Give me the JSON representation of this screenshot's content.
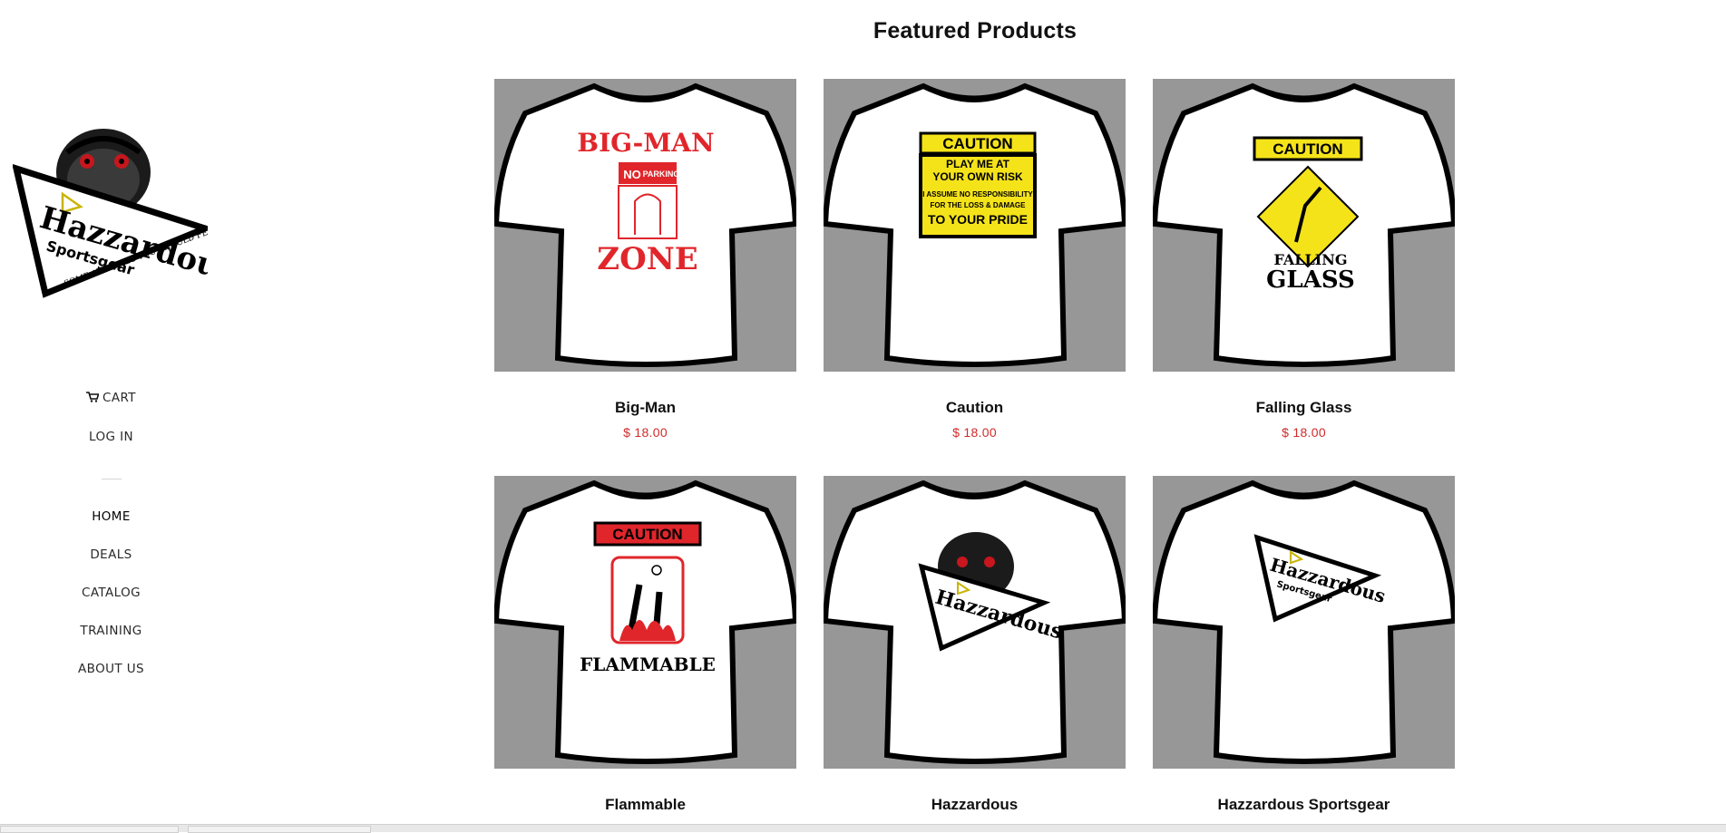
{
  "brand": {
    "logo_text": "Hazzardous",
    "logo_subtext": "Sportsgear",
    "logo_tagline": "SOME ATHLETES YOU SHOULD FEAR..."
  },
  "account_nav": {
    "cart_label": "CART",
    "login_label": "LOG IN"
  },
  "main_nav": [
    {
      "label": "HOME"
    },
    {
      "label": "DEALS"
    },
    {
      "label": "CATALOG"
    },
    {
      "label": "TRAINING"
    },
    {
      "label": "ABOUT US"
    }
  ],
  "featured": {
    "title": "Featured Products",
    "products": [
      {
        "name": "Big-Man",
        "price": "$ 18.00",
        "design": "big-man",
        "art": [
          "BIG-MAN",
          "NO",
          "PARKING",
          "ZONE"
        ]
      },
      {
        "name": "Caution",
        "price": "$ 18.00",
        "design": "caution",
        "art": [
          "CAUTION",
          "PLAY ME AT",
          "YOUR OWN RISK",
          "I ASSUME NO RESPONSIBILITY",
          "FOR THE LOSS & DAMAGE",
          "TO YOUR PRIDE"
        ]
      },
      {
        "name": "Falling Glass",
        "price": "$ 18.00",
        "design": "falling-glass",
        "art": [
          "CAUTION",
          "FALLING",
          "GLASS"
        ]
      },
      {
        "name": "Flammable",
        "design": "flammable",
        "art": [
          "CAUTION",
          "FLAMMABLE"
        ]
      },
      {
        "name": "Hazzardous",
        "design": "hazzardous"
      },
      {
        "name": "Hazzardous Sportsgear",
        "design": "hazzardous-sportsgear"
      }
    ]
  },
  "colors": {
    "price": "#d12a2a",
    "thumb_bg": "#979797",
    "caution_yellow": "#f5e31a",
    "accent_red": "#e0262b"
  }
}
